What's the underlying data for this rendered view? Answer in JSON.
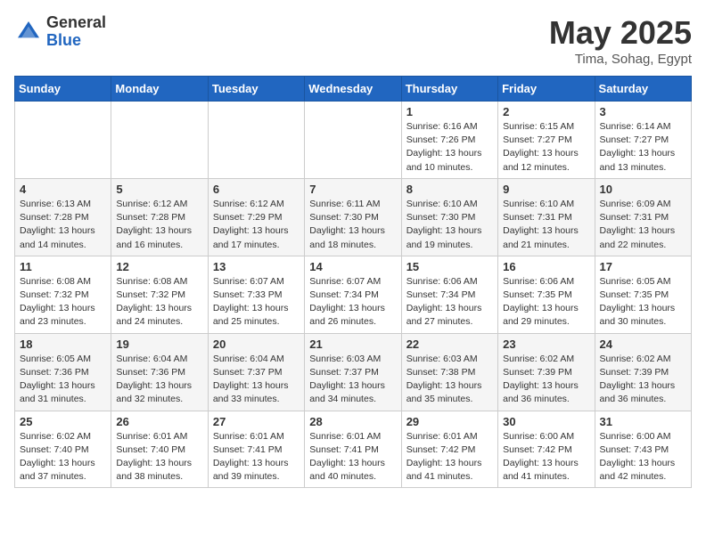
{
  "header": {
    "logo_general": "General",
    "logo_blue": "Blue",
    "month_title": "May 2025",
    "location": "Tima, Sohag, Egypt"
  },
  "weekdays": [
    "Sunday",
    "Monday",
    "Tuesday",
    "Wednesday",
    "Thursday",
    "Friday",
    "Saturday"
  ],
  "weeks": [
    [
      {
        "day": "",
        "info": ""
      },
      {
        "day": "",
        "info": ""
      },
      {
        "day": "",
        "info": ""
      },
      {
        "day": "",
        "info": ""
      },
      {
        "day": "1",
        "info": "Sunrise: 6:16 AM\nSunset: 7:26 PM\nDaylight: 13 hours\nand 10 minutes."
      },
      {
        "day": "2",
        "info": "Sunrise: 6:15 AM\nSunset: 7:27 PM\nDaylight: 13 hours\nand 12 minutes."
      },
      {
        "day": "3",
        "info": "Sunrise: 6:14 AM\nSunset: 7:27 PM\nDaylight: 13 hours\nand 13 minutes."
      }
    ],
    [
      {
        "day": "4",
        "info": "Sunrise: 6:13 AM\nSunset: 7:28 PM\nDaylight: 13 hours\nand 14 minutes."
      },
      {
        "day": "5",
        "info": "Sunrise: 6:12 AM\nSunset: 7:28 PM\nDaylight: 13 hours\nand 16 minutes."
      },
      {
        "day": "6",
        "info": "Sunrise: 6:12 AM\nSunset: 7:29 PM\nDaylight: 13 hours\nand 17 minutes."
      },
      {
        "day": "7",
        "info": "Sunrise: 6:11 AM\nSunset: 7:30 PM\nDaylight: 13 hours\nand 18 minutes."
      },
      {
        "day": "8",
        "info": "Sunrise: 6:10 AM\nSunset: 7:30 PM\nDaylight: 13 hours\nand 19 minutes."
      },
      {
        "day": "9",
        "info": "Sunrise: 6:10 AM\nSunset: 7:31 PM\nDaylight: 13 hours\nand 21 minutes."
      },
      {
        "day": "10",
        "info": "Sunrise: 6:09 AM\nSunset: 7:31 PM\nDaylight: 13 hours\nand 22 minutes."
      }
    ],
    [
      {
        "day": "11",
        "info": "Sunrise: 6:08 AM\nSunset: 7:32 PM\nDaylight: 13 hours\nand 23 minutes."
      },
      {
        "day": "12",
        "info": "Sunrise: 6:08 AM\nSunset: 7:32 PM\nDaylight: 13 hours\nand 24 minutes."
      },
      {
        "day": "13",
        "info": "Sunrise: 6:07 AM\nSunset: 7:33 PM\nDaylight: 13 hours\nand 25 minutes."
      },
      {
        "day": "14",
        "info": "Sunrise: 6:07 AM\nSunset: 7:34 PM\nDaylight: 13 hours\nand 26 minutes."
      },
      {
        "day": "15",
        "info": "Sunrise: 6:06 AM\nSunset: 7:34 PM\nDaylight: 13 hours\nand 27 minutes."
      },
      {
        "day": "16",
        "info": "Sunrise: 6:06 AM\nSunset: 7:35 PM\nDaylight: 13 hours\nand 29 minutes."
      },
      {
        "day": "17",
        "info": "Sunrise: 6:05 AM\nSunset: 7:35 PM\nDaylight: 13 hours\nand 30 minutes."
      }
    ],
    [
      {
        "day": "18",
        "info": "Sunrise: 6:05 AM\nSunset: 7:36 PM\nDaylight: 13 hours\nand 31 minutes."
      },
      {
        "day": "19",
        "info": "Sunrise: 6:04 AM\nSunset: 7:36 PM\nDaylight: 13 hours\nand 32 minutes."
      },
      {
        "day": "20",
        "info": "Sunrise: 6:04 AM\nSunset: 7:37 PM\nDaylight: 13 hours\nand 33 minutes."
      },
      {
        "day": "21",
        "info": "Sunrise: 6:03 AM\nSunset: 7:37 PM\nDaylight: 13 hours\nand 34 minutes."
      },
      {
        "day": "22",
        "info": "Sunrise: 6:03 AM\nSunset: 7:38 PM\nDaylight: 13 hours\nand 35 minutes."
      },
      {
        "day": "23",
        "info": "Sunrise: 6:02 AM\nSunset: 7:39 PM\nDaylight: 13 hours\nand 36 minutes."
      },
      {
        "day": "24",
        "info": "Sunrise: 6:02 AM\nSunset: 7:39 PM\nDaylight: 13 hours\nand 36 minutes."
      }
    ],
    [
      {
        "day": "25",
        "info": "Sunrise: 6:02 AM\nSunset: 7:40 PM\nDaylight: 13 hours\nand 37 minutes."
      },
      {
        "day": "26",
        "info": "Sunrise: 6:01 AM\nSunset: 7:40 PM\nDaylight: 13 hours\nand 38 minutes."
      },
      {
        "day": "27",
        "info": "Sunrise: 6:01 AM\nSunset: 7:41 PM\nDaylight: 13 hours\nand 39 minutes."
      },
      {
        "day": "28",
        "info": "Sunrise: 6:01 AM\nSunset: 7:41 PM\nDaylight: 13 hours\nand 40 minutes."
      },
      {
        "day": "29",
        "info": "Sunrise: 6:01 AM\nSunset: 7:42 PM\nDaylight: 13 hours\nand 41 minutes."
      },
      {
        "day": "30",
        "info": "Sunrise: 6:00 AM\nSunset: 7:42 PM\nDaylight: 13 hours\nand 41 minutes."
      },
      {
        "day": "31",
        "info": "Sunrise: 6:00 AM\nSunset: 7:43 PM\nDaylight: 13 hours\nand 42 minutes."
      }
    ]
  ]
}
